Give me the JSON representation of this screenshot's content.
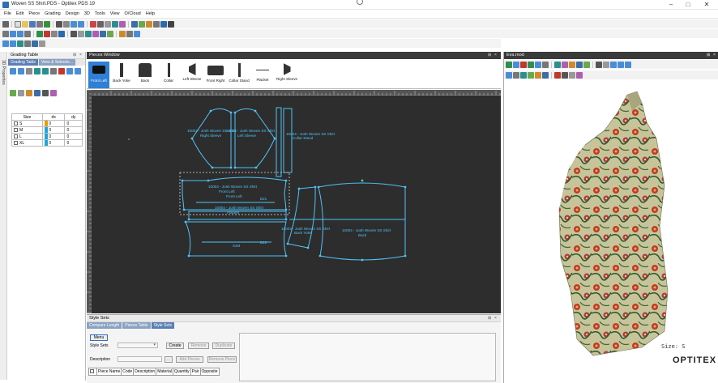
{
  "window": {
    "title": "Woven SS Shirt.PDS - Optitex PDS 19",
    "controls": [
      "–",
      "□",
      "✕"
    ]
  },
  "menu": [
    "File",
    "Edit",
    "Piece",
    "Grading",
    "Design",
    "3D",
    "Tools",
    "View",
    "O/Cloud",
    "Help"
  ],
  "left_strip": {
    "label": "3D Properties"
  },
  "grading_panel": {
    "title": "Grading Table",
    "tabs": [
      "Grading Table",
      "View & Selectio..."
    ],
    "columns": [
      "Size",
      "dx",
      "dy"
    ],
    "rows": [
      {
        "size": "S",
        "dx": "0",
        "dy": "0",
        "color": "#e6a000"
      },
      {
        "size": "M",
        "dx": "0",
        "dy": "0",
        "color": "#1aa7e0"
      },
      {
        "size": "L",
        "dx": "0",
        "dy": "0",
        "color": "#1aa7e0"
      },
      {
        "size": "XL",
        "dx": "0",
        "dy": "0",
        "color": "#1aa7e0"
      }
    ]
  },
  "pieces_window": {
    "title": "Pieces Window",
    "pieces": [
      {
        "label": "Front Left"
      },
      {
        "label": "Back Yoke"
      },
      {
        "label": "Back"
      },
      {
        "label": "Collar"
      },
      {
        "label": "Left Sleeve"
      },
      {
        "label": "Front Right"
      },
      {
        "label": "Collar Stand"
      },
      {
        "label": "Placket"
      },
      {
        "label": "Right Sleeve"
      }
    ]
  },
  "canvas": {
    "texts": [
      "10004 - Josh Woven SS Shirt",
      "Right Sleeve",
      "10004 - Josh Woven SS Shirt",
      "Left Sleeve",
      "10004 - Josh Woven SS Shirt",
      "Collar Stand",
      "10004 - Josh Woven SS Shirt",
      "Front Left",
      "Front Left",
      "10004 - Josh Woven SS Shirt",
      "Placket",
      "10004 - Josh Woven SS Shirt",
      "Back Yoke",
      "10004 - Josh Woven SS Shirt",
      "Back",
      "SxM",
      "B21",
      "B22"
    ]
  },
  "style_sets": {
    "title": "Style Sets",
    "tabs": [
      "Compare Length",
      "Pieces Table",
      "Style Sets"
    ],
    "menu_button": "Menu",
    "style_sets_label": "Style Sets",
    "description_label": "Description",
    "buttons": {
      "create": "Create",
      "remove": "Remove",
      "duplicate": "Duplicate",
      "add_pieces": "Add Pieces",
      "remove_pieces": "Remove Piece"
    },
    "table_headers": [
      "Piece Name",
      "Code",
      "Description",
      "Material",
      "Quantity",
      "Pair",
      "Opposite"
    ]
  },
  "viewer": {
    "title": "Eva.mod",
    "size_label": "Size: S",
    "brand": "OPTITEX"
  },
  "colors": {
    "accent": "#2f7fd6",
    "pattern_line": "#4fc3f7",
    "canvas_bg": "#2d2d2d",
    "panel_header": "#3a3a3a"
  }
}
